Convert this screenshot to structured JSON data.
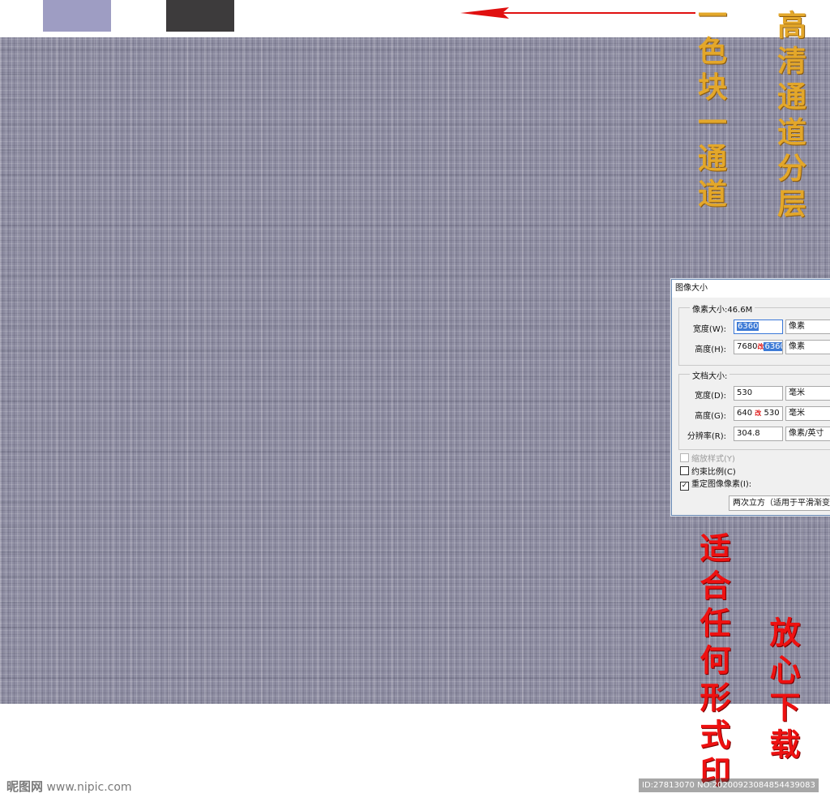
{
  "swatches": [
    {
      "name": "swatch-lavender",
      "color": "#9e9dc3"
    },
    {
      "name": "swatch-charcoal",
      "color": "#3d3b3c"
    }
  ],
  "annotations": {
    "gold_1": "一色块一通道",
    "gold_2": "高清通道分层",
    "red_1": "适合任何形式印",
    "red_2": "放心下载",
    "gold_color": "#e3a72a",
    "red_color": "#ee1111",
    "arrow_color": "#e01010",
    "arrow_icon": "left-arrow-icon"
  },
  "dialog": {
    "title": "图像大小",
    "pixel_group": {
      "legend": "像素大小:46.6M",
      "width": {
        "label": "宽度(W):",
        "value": "6360",
        "unit": "像素"
      },
      "height": {
        "label": "高度(H):",
        "value": "7680",
        "annot": "改",
        "selected": "6360",
        "unit": "像素"
      }
    },
    "doc_group": {
      "legend": "文档大小:",
      "width": {
        "label": "宽度(D):",
        "value": "530",
        "unit": "毫米"
      },
      "height": {
        "label": "高度(G):",
        "value": "640",
        "annot": "改",
        "new": "530",
        "unit": "毫米"
      },
      "resolution": {
        "label": "分辨率(R):",
        "value": "304.8",
        "unit": "像素/英寸"
      }
    },
    "options": {
      "scale_styles": "缩放样式(Y)",
      "constrain": "约束比例(C)",
      "resample": "重定图像像素(I):",
      "resample_method": "两次立方（适用于平滑渐变"
    }
  },
  "watermark": {
    "logo": "昵图网",
    "site": "www.nipic.com",
    "id": "ID:27813070 NO:20200923084854439083"
  }
}
